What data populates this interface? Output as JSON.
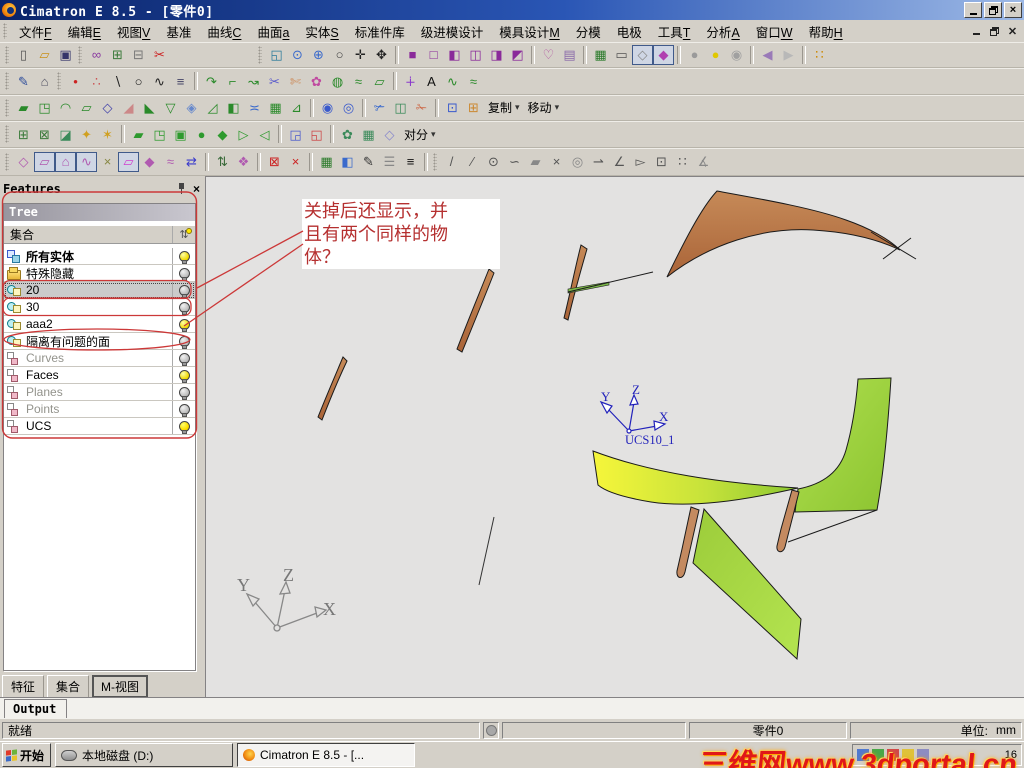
{
  "window": {
    "title": "Cimatron E 8.5 - [零件0]"
  },
  "menu": {
    "items": [
      {
        "id": "file",
        "label": "文件",
        "mn": "F"
      },
      {
        "id": "edit",
        "label": "编辑",
        "mn": "E"
      },
      {
        "id": "view",
        "label": "视图",
        "mn": "V"
      },
      {
        "id": "datum",
        "label": "基准",
        "mn": ""
      },
      {
        "id": "curves",
        "label": "曲线",
        "mn": "C"
      },
      {
        "id": "surface",
        "label": "曲面",
        "mn": "a"
      },
      {
        "id": "solid",
        "label": "实体",
        "mn": "S"
      },
      {
        "id": "standard-parts",
        "label": "标准件库",
        "mn": ""
      },
      {
        "id": "progressive-die",
        "label": "级进模设计",
        "mn": ""
      },
      {
        "id": "mold-design",
        "label": "模具设计",
        "mn": "M"
      },
      {
        "id": "parting",
        "label": "分模",
        "mn": ""
      },
      {
        "id": "electrode",
        "label": "电极",
        "mn": ""
      },
      {
        "id": "tools",
        "label": "工具",
        "mn": "T"
      },
      {
        "id": "analysis",
        "label": "分析",
        "mn": "A"
      },
      {
        "id": "window-menu",
        "label": "窗口",
        "mn": "W"
      },
      {
        "id": "help",
        "label": "帮助",
        "mn": "H"
      }
    ]
  },
  "toolbars": {
    "rows": [
      {
        "name": "standard-view",
        "items": [
          {
            "grip": true
          },
          {
            "n": "new-file",
            "g": "▯",
            "c": "#555"
          },
          {
            "n": "open-file",
            "g": "▱",
            "c": "#c89018"
          },
          {
            "n": "save-file",
            "g": "▣",
            "c": "#35356a"
          },
          {
            "grip": true
          },
          {
            "n": "link-display",
            "g": "∞",
            "c": "#8a3aa0"
          },
          {
            "n": "copy-feature-tree",
            "g": "⊞",
            "c": "#3a7a3a"
          },
          {
            "n": "delete-feature-tree",
            "g": "⊟",
            "c": "#777"
          },
          {
            "n": "delete-selected",
            "g": "✂",
            "c": "#cc2020"
          },
          {
            "sp": 86
          },
          {
            "grip": true
          },
          {
            "n": "zoom-fit",
            "g": "◱",
            "c": "#2a7a9a"
          },
          {
            "n": "zoom-selected",
            "g": "⊙",
            "c": "#3a6acc"
          },
          {
            "n": "zoom-window",
            "g": "⊕",
            "c": "#3a6acc"
          },
          {
            "n": "zoom-dynamic",
            "g": "○",
            "c": "#444"
          },
          {
            "n": "pan-view",
            "g": "✛",
            "c": "#222"
          },
          {
            "n": "rotate-view",
            "g": "✥",
            "c": "#222"
          },
          {
            "sep": true
          },
          {
            "n": "shaded-cube-display",
            "g": "■",
            "c": "#8a2a9a"
          },
          {
            "n": "wireframe-cube-display",
            "g": "□",
            "c": "#8a2a9a"
          },
          {
            "n": "hidden-edges-display",
            "g": "◧",
            "c": "#8a2a9a"
          },
          {
            "n": "transparent-display",
            "g": "◫",
            "c": "#8a2a9a"
          },
          {
            "n": "half-section-display",
            "g": "◨",
            "c": "#8a2a9a"
          },
          {
            "n": "quarter-display",
            "g": "◩",
            "c": "#8a2a9a"
          },
          {
            "sep": true
          },
          {
            "n": "render-preview",
            "g": "♡",
            "c": "#b050a0"
          },
          {
            "n": "snapshot",
            "g": "▤",
            "c": "#8a6aaa"
          },
          {
            "sep": true
          },
          {
            "n": "textured-display",
            "g": "▦",
            "c": "#2a7a2a"
          },
          {
            "n": "wire-display",
            "g": "▭",
            "c": "#555"
          },
          {
            "n": "wireframe-mode",
            "g": "◇",
            "c": "#8a8a8a",
            "p": true
          },
          {
            "n": "shaded-mode",
            "g": "◆",
            "c": "#b040b0",
            "p": true
          },
          {
            "sep": true
          },
          {
            "n": "light-off",
            "g": "●",
            "c": "#9a9a9a"
          },
          {
            "n": "light-on",
            "g": "●",
            "c": "#e0c800"
          },
          {
            "n": "pick-light",
            "g": "◉",
            "c": "#a0a0a0"
          },
          {
            "sep": true
          },
          {
            "n": "previous-view",
            "g": "◀",
            "c": "#9a7ab8"
          },
          {
            "n": "next-view",
            "g": "▶",
            "c": "#b8b8b8"
          },
          {
            "sep": true
          },
          {
            "n": "display-options",
            "g": "∷",
            "c": "#cc8800"
          }
        ]
      },
      {
        "name": "sketch-curves",
        "items": [
          {
            "grip": true
          },
          {
            "n": "sketcher",
            "g": "✎",
            "c": "#2a4a9a"
          },
          {
            "n": "profile-tool",
            "g": "⌂",
            "c": "#556"
          },
          {
            "grip": true
          },
          {
            "n": "point-tool",
            "g": "•",
            "c": "#cc2222"
          },
          {
            "n": "points-cloud",
            "g": "∴",
            "c": "#cc5555"
          },
          {
            "n": "line-tool",
            "g": "∖",
            "c": "#222"
          },
          {
            "n": "circle-tool",
            "g": "○",
            "c": "#222"
          },
          {
            "n": "spline-tool",
            "g": "∿",
            "c": "#222"
          },
          {
            "n": "helix-tool",
            "g": "≡",
            "c": "#446"
          },
          {
            "sep": true
          },
          {
            "n": "fillet-curve",
            "g": "↷",
            "c": "#2a8a2a"
          },
          {
            "n": "tangent-curve",
            "g": "⌐",
            "c": "#2a8a2a"
          },
          {
            "n": "extend-curve",
            "g": "↝",
            "c": "#2a8a2a"
          },
          {
            "n": "trim-curve",
            "g": "✂",
            "c": "#5a5acc"
          },
          {
            "n": "split-curve",
            "g": "✄",
            "c": "#cc8855"
          },
          {
            "n": "composite-curve",
            "g": "✿",
            "c": "#c04aa0"
          },
          {
            "n": "wrap-curve",
            "g": "◍",
            "c": "#2a8a2a"
          },
          {
            "n": "project-curve",
            "g": "≈",
            "c": "#2a8a2a"
          },
          {
            "n": "section-curve",
            "g": "▱",
            "c": "#2a8a2a"
          },
          {
            "sep": true
          },
          {
            "n": "curve-analysis",
            "g": "∔",
            "c": "#8a3acc"
          },
          {
            "n": "text-tool",
            "g": "A",
            "c": "#111"
          },
          {
            "n": "add-curve-wave",
            "g": "∿",
            "c": "#2a8a2a"
          },
          {
            "n": "reduce-curve-wave",
            "g": "≈",
            "c": "#2a8a2a"
          }
        ]
      },
      {
        "name": "surfaces",
        "items": [
          {
            "grip": true
          },
          {
            "n": "drive-surface",
            "g": "▰",
            "c": "#2a8a2a"
          },
          {
            "n": "revolve-surface",
            "g": "◳",
            "c": "#2a8a2a"
          },
          {
            "n": "sweep-surface",
            "g": "◠",
            "c": "#2a8a2a"
          },
          {
            "n": "ruled-surface",
            "g": "▱",
            "c": "#2a8a2a"
          },
          {
            "n": "blend-surface",
            "g": "◇",
            "c": "#4444aa"
          },
          {
            "n": "mirror-surface",
            "g": "◢",
            "c": "#cc8888"
          },
          {
            "n": "extrude-surface",
            "g": "◣",
            "c": "#2a8a2a"
          },
          {
            "n": "loft-surface",
            "g": "▽",
            "c": "#2a8a2a"
          },
          {
            "n": "offset-surface",
            "g": "◈",
            "c": "#6688cc"
          },
          {
            "n": "fillet-surface",
            "g": "◿",
            "c": "#2a8a2a"
          },
          {
            "n": "extend-surface",
            "g": "◧",
            "c": "#2a8a2a"
          },
          {
            "n": "mid-surface",
            "g": "≍",
            "c": "#3a6acc"
          },
          {
            "n": "dart-surface",
            "g": "▦",
            "c": "#2a8a2a"
          },
          {
            "n": "skin-surface",
            "g": "⊿",
            "c": "#2a8a2a"
          },
          {
            "sep": true
          },
          {
            "n": "stitch-surfaces",
            "g": "◉",
            "c": "#3a5acc"
          },
          {
            "n": "unstitch-surfaces",
            "g": "◎",
            "c": "#3a5acc"
          },
          {
            "sep": true
          },
          {
            "n": "trim-surface",
            "g": "✃",
            "c": "#3a6acc"
          },
          {
            "n": "split-surface",
            "g": "◫",
            "c": "#3a8a5a"
          },
          {
            "n": "untrim-surface",
            "g": "✁",
            "c": "#cc6644"
          },
          {
            "sep": true
          },
          {
            "n": "extend-boundary",
            "g": "⊡",
            "c": "#3a5acc"
          },
          {
            "n": "rebound-surface",
            "g": "⊞",
            "c": "#cc8830"
          },
          {
            "n": "copy-dropdown",
            "label": "复制"
          },
          {
            "n": "move-dropdown",
            "label": "移动"
          }
        ]
      },
      {
        "name": "solids",
        "items": [
          {
            "grip": true
          },
          {
            "n": "new-solid",
            "g": "⊞",
            "c": "#3a7a3a"
          },
          {
            "n": "stock-solid",
            "g": "⊠",
            "c": "#3a7a3a"
          },
          {
            "n": "thicken-solid",
            "g": "◪",
            "c": "#3a8a5a"
          },
          {
            "n": "alert-tool",
            "g": "✦",
            "c": "#d0a020"
          },
          {
            "n": "magic-tool",
            "g": "✶",
            "c": "#d0a020"
          },
          {
            "sep": true
          },
          {
            "n": "offset-solid",
            "g": "▰",
            "c": "#2e9a2e"
          },
          {
            "n": "drive-solid",
            "g": "◳",
            "c": "#2e9a2e"
          },
          {
            "n": "pocket-solid",
            "g": "▣",
            "c": "#2e9a2e"
          },
          {
            "n": "round-solid",
            "g": "●",
            "c": "#2e9a2e"
          },
          {
            "n": "chamfer-solid",
            "g": "◆",
            "c": "#2e9a2e"
          },
          {
            "n": "draft-solid",
            "g": "▷",
            "c": "#2e9a2e"
          },
          {
            "n": "shell-solid",
            "g": "◁",
            "c": "#2e9a2e"
          },
          {
            "sep": true
          },
          {
            "n": "boolean-add",
            "g": "◲",
            "c": "#4a5acc"
          },
          {
            "n": "boolean-remove",
            "g": "◱",
            "c": "#cc4444"
          },
          {
            "sep": true
          },
          {
            "n": "pattern-tool",
            "g": "✿",
            "c": "#3a8a5a"
          },
          {
            "n": "frame-tool",
            "g": "▦",
            "c": "#3a8a5a"
          },
          {
            "n": "cube-tool",
            "g": "◇",
            "c": "#8888cc"
          },
          {
            "n": "bisect-dropdown",
            "label": "对分"
          }
        ]
      },
      {
        "name": "filters-measure",
        "items": [
          {
            "grip": true
          },
          {
            "n": "filter-all",
            "g": "◇",
            "c": "#b05ab0"
          },
          {
            "n": "filter-faces",
            "g": "▱",
            "c": "#b05ab0",
            "p": true
          },
          {
            "n": "filter-contours",
            "g": "⌂",
            "c": "#b05ab0",
            "p": true
          },
          {
            "n": "filter-curves",
            "g": "∿",
            "c": "#b05ab0",
            "p": true
          },
          {
            "n": "filter-points",
            "g": "×",
            "c": "#888844"
          },
          {
            "n": "filter-sketches",
            "g": "▱",
            "c": "#d040d0",
            "p": true
          },
          {
            "n": "filter-solids",
            "g": "◆",
            "c": "#b05ab0"
          },
          {
            "n": "filter-groups",
            "g": "≈",
            "c": "#b05ab0"
          },
          {
            "n": "filter-reverse",
            "g": "⇄",
            "c": "#3a3acc"
          },
          {
            "sep": true
          },
          {
            "n": "pick-order",
            "g": "⇅",
            "c": "#3a6a3a"
          },
          {
            "n": "pick-funnel",
            "g": "❖",
            "c": "#b05ab0"
          },
          {
            "sep": true
          },
          {
            "n": "box-pick",
            "g": "⊠",
            "c": "#cc2222"
          },
          {
            "n": "cancel-pick",
            "g": "×",
            "c": "#cc2222"
          },
          {
            "sep": true
          },
          {
            "n": "color-table",
            "g": "▦",
            "c": "#2a7a2a"
          },
          {
            "n": "paint-bucket",
            "g": "◧",
            "c": "#3a6acc"
          },
          {
            "n": "color-picker",
            "g": "✎",
            "c": "#333"
          },
          {
            "n": "line-style",
            "g": "☰",
            "c": "#888"
          },
          {
            "n": "line-width",
            "g": "≡",
            "c": "#111"
          },
          {
            "sep": true
          },
          {
            "grip": true
          },
          {
            "n": "measure-line",
            "g": "/",
            "c": "#555"
          },
          {
            "n": "measure-point",
            "g": "∕",
            "c": "#555"
          },
          {
            "n": "measure-circle",
            "g": "⊙",
            "c": "#555"
          },
          {
            "n": "measure-tangent",
            "g": "∽",
            "c": "#555"
          },
          {
            "n": "measure-plane",
            "g": "▰",
            "c": "#888"
          },
          {
            "n": "measure-intersect",
            "g": "×",
            "c": "#555"
          },
          {
            "n": "measure-visibility",
            "g": "◎",
            "c": "#888"
          },
          {
            "n": "measure-direction",
            "g": "⇀",
            "c": "#555"
          },
          {
            "n": "measure-angle",
            "g": "∠",
            "c": "#555"
          },
          {
            "n": "measure-cursor",
            "g": "▻",
            "c": "#555"
          },
          {
            "n": "measure-target",
            "g": "⊡",
            "c": "#555"
          },
          {
            "n": "point-coordinates",
            "g": "∷",
            "c": "#555"
          },
          {
            "n": "delta-angle",
            "g": "∡",
            "c": "#888"
          }
        ]
      }
    ]
  },
  "features_panel": {
    "title": "Features",
    "tree_caption": "Tree",
    "header_label": "集合",
    "rows": [
      {
        "id": "all-entities",
        "label": "所有实体",
        "icon": "icon-entities",
        "bulb": "yellow",
        "bold": true
      },
      {
        "id": "special-hidden",
        "label": "特殊隐藏",
        "icon": "icon-hidden",
        "bulb": "gray"
      },
      {
        "id": "set-20",
        "label": "20",
        "icon": "icon-set",
        "bulb": "gray",
        "selected": true
      },
      {
        "id": "set-30",
        "label": "30",
        "icon": "icon-set",
        "bulb": "gray"
      },
      {
        "id": "set-aaa2",
        "label": "aaa2",
        "icon": "icon-set",
        "bulb": "yellow"
      },
      {
        "id": "isolate-problem-faces",
        "label": "隔离有问题的面",
        "icon": "icon-set",
        "bulb": "gray"
      },
      {
        "id": "curves",
        "label": "Curves",
        "icon": "icon-cat",
        "bulb": "gray",
        "dim": true
      },
      {
        "id": "faces",
        "label": "Faces",
        "icon": "icon-cat",
        "bulb": "yellow"
      },
      {
        "id": "planes",
        "label": "Planes",
        "icon": "icon-cat",
        "bulb": "gray",
        "dim": true
      },
      {
        "id": "points",
        "label": "Points",
        "icon": "icon-cat",
        "bulb": "gray",
        "dim": true
      },
      {
        "id": "ucs",
        "label": "UCS",
        "icon": "icon-cat",
        "bulb": "bright"
      }
    ],
    "tabs": [
      {
        "id": "features",
        "label": "特征"
      },
      {
        "id": "sets",
        "label": "集合"
      },
      {
        "id": "m-views",
        "label": "M-视图",
        "boxed": true
      }
    ]
  },
  "annotation": {
    "lines": [
      "关掉后还显示，并",
      "且有两个同样的物",
      "体？"
    ]
  },
  "viewport": {
    "axes": {
      "x": "X",
      "y": "Y",
      "z": "Z"
    },
    "ucs_name": "UCS10_1"
  },
  "output": {
    "tab_label": "Output"
  },
  "statusbar": {
    "ready": "就绪",
    "part_name": "零件0",
    "units_label": "单位:",
    "units_value": "mm"
  },
  "taskbar": {
    "start_label": "开始",
    "buttons": [
      {
        "label": "本地磁盘 (D:)"
      },
      {
        "label": "Cimatron E 8.5 - [..."
      }
    ],
    "watermark": "三维网www.3dportal.cn",
    "clock": "16"
  }
}
